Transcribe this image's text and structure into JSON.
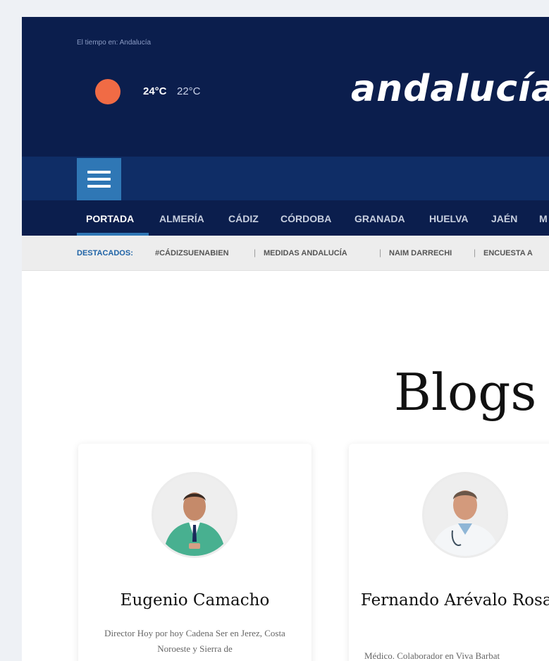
{
  "header": {
    "weather_label": "El tiempo en: Andalucía",
    "temp_high": "24°C",
    "temp_low": "22°C",
    "logo_text": "andalucía"
  },
  "nav": {
    "provinces": [
      "PORTADA",
      "ALMERÍA",
      "CÁDIZ",
      "CÓRDOBA",
      "GRANADA",
      "HUELVA",
      "JAÉN",
      "M"
    ]
  },
  "trending": {
    "label": "DESTACADOS:",
    "items": [
      "#CÁDIZSUENABIEN",
      "MEDIDAS ANDALUCÍA",
      "NAIM DARRECHI",
      "ENCUESTA A"
    ]
  },
  "page": {
    "title": "Blogs d"
  },
  "authors": [
    {
      "name": "Eugenio Camacho",
      "bio": "Director Hoy por hoy Cadena Ser en Jerez, Costa Noroeste y Sierra de"
    },
    {
      "name": "Fernando Arévalo Rosado",
      "bio": "Médico. Colaborador en Viva Barbat"
    }
  ],
  "colors": {
    "header_bg": "#0b1e4d",
    "navbar_bg": "#0f2d66",
    "accent": "#2f77b5",
    "sun": "#f06b45"
  }
}
